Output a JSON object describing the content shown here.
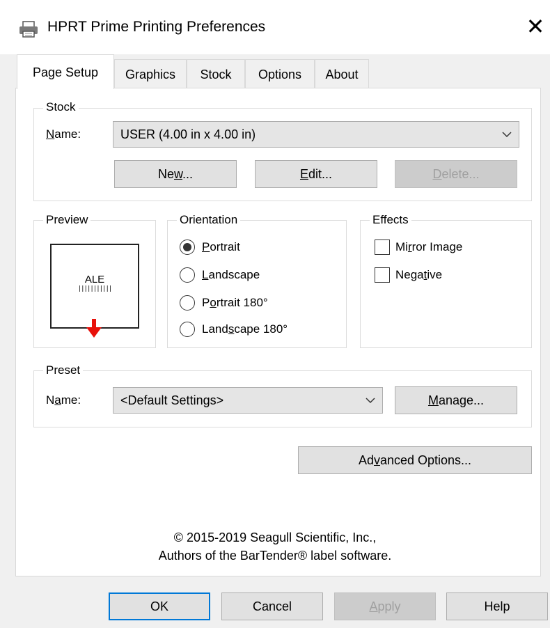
{
  "window": {
    "title": "HPRT Prime Printing Preferences",
    "icon": "printer-icon",
    "close_glyph": "✕"
  },
  "tabs": [
    {
      "label": "Page Setup",
      "active": true
    },
    {
      "label": "Graphics",
      "active": false
    },
    {
      "label": "Stock",
      "active": false
    },
    {
      "label": "Options",
      "active": false
    },
    {
      "label": "About",
      "active": false
    }
  ],
  "stock": {
    "legend": "Stock",
    "name_label_mn": "N",
    "name_label_rest": "ame:",
    "name_value": "USER (4.00 in x 4.00 in)",
    "new_pre": "Ne",
    "new_mn": "w",
    "new_post": "...",
    "edit_mn": "E",
    "edit_post": "dit...",
    "delete_mn": "D",
    "delete_post": "elete..."
  },
  "preview": {
    "legend": "Preview",
    "sample_text": "ALE",
    "barcode": "|||||||||||"
  },
  "orientation": {
    "legend": "Orientation",
    "options": [
      {
        "mn": "P",
        "rest": "ortrait",
        "pre": "",
        "selected": true
      },
      {
        "mn": "L",
        "rest": "andscape",
        "pre": "",
        "selected": false
      },
      {
        "pre": "P",
        "mn": "o",
        "rest": "rtrait 180°",
        "selected": false
      },
      {
        "pre": "Land",
        "mn": "s",
        "rest": "cape 180°",
        "selected": false
      }
    ]
  },
  "effects": {
    "legend": "Effects",
    "mirror": {
      "pre": "Mi",
      "mn": "r",
      "rest": "ror Image",
      "checked": false
    },
    "negative": {
      "pre": "Nega",
      "mn": "t",
      "rest": "ive",
      "checked": false
    }
  },
  "preset": {
    "legend": "Preset",
    "name_pre": "N",
    "name_mn": "a",
    "name_rest": "me:",
    "value": "<Default Settings>",
    "manage_mn": "M",
    "manage_rest": "anage..."
  },
  "advanced": {
    "pre": "Ad",
    "mn": "v",
    "rest": "anced Options..."
  },
  "copyright": {
    "line1": "© 2015-2019 Seagull Scientific, Inc.,",
    "line2": "Authors of the BarTender® label software."
  },
  "buttons": {
    "ok": "OK",
    "cancel": "Cancel",
    "apply_mn": "A",
    "apply_rest": "pply",
    "help": "Help"
  },
  "colors": {
    "accent": "#0078d7",
    "arrow": "#e8110b",
    "dialog_bg": "#f0f0f0"
  }
}
